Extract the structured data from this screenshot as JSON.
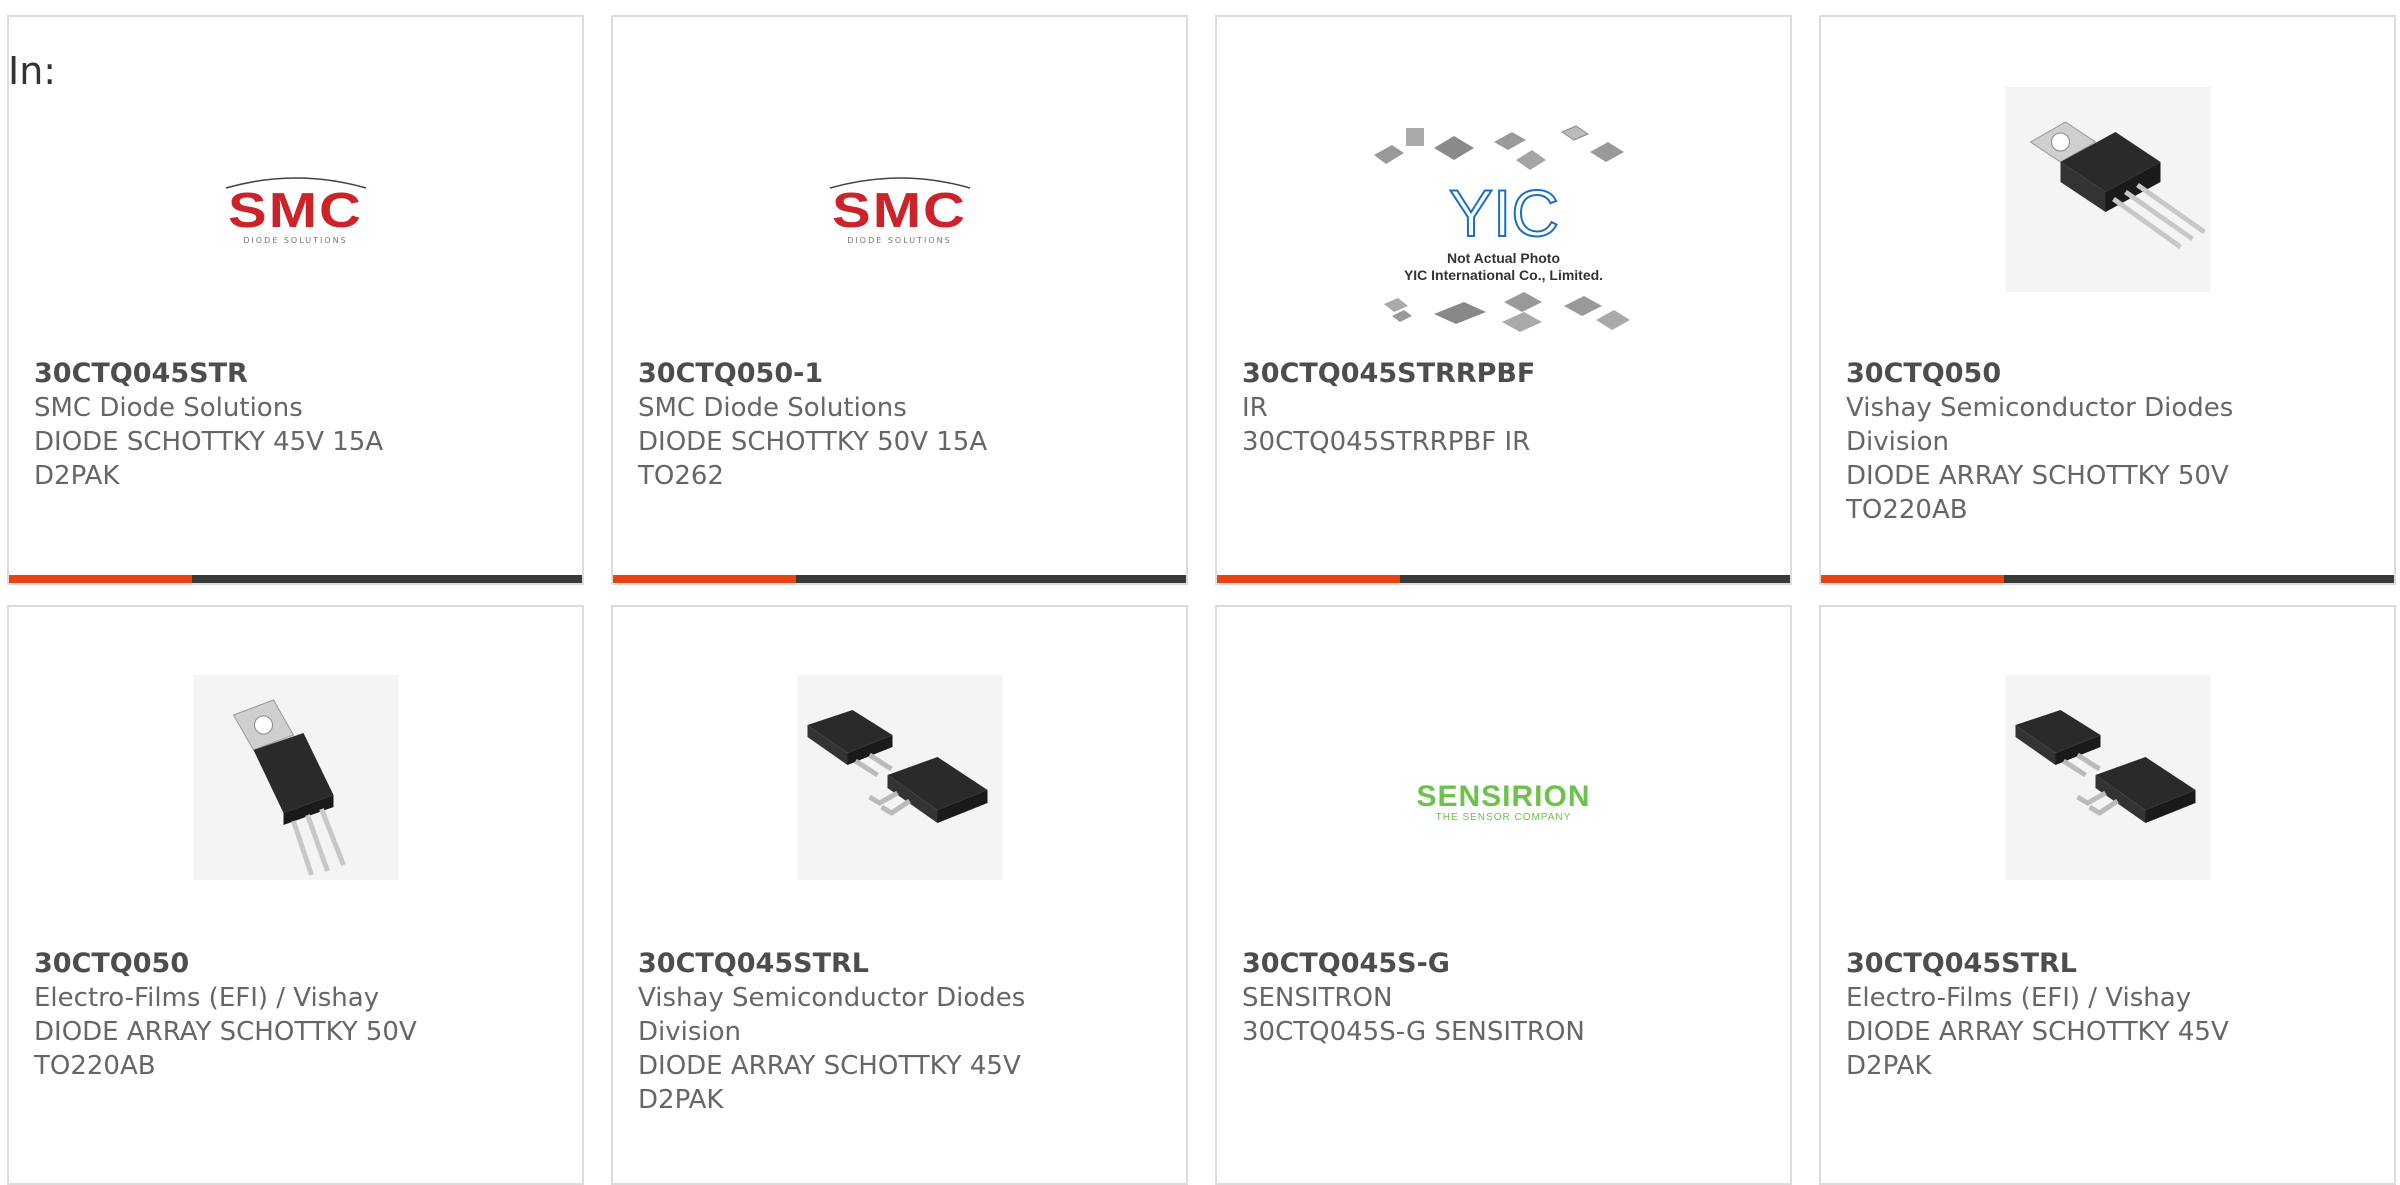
{
  "header": {
    "in_label": "In:"
  },
  "colors": {
    "accent": "#e84315",
    "bar_dark": "#3a3a3a",
    "card_border": "#dcdcdc",
    "text": "#666666"
  },
  "logos": {
    "smc_text": "SMC",
    "smc_sub": "DIODE SOLUTIONS",
    "yic_mark": "YIC",
    "yic_note1": "Not Actual Photo",
    "yic_note2": "YIC International Co., Limited.",
    "sensirion_main": "SENSIRION",
    "sensirion_sub": "THE SENSOR COMPANY"
  },
  "products": [
    {
      "part": "30CTQ045STR",
      "lines": [
        "SMC Diode Solutions",
        "DIODE SCHOTTKY 45V 15A",
        "D2PAK"
      ],
      "image": "smc-logo"
    },
    {
      "part": "30CTQ050-1",
      "lines": [
        "SMC Diode Solutions",
        "DIODE SCHOTTKY 50V 15A",
        "TO262"
      ],
      "image": "smc-logo"
    },
    {
      "part": "30CTQ045STRRPBF",
      "lines": [
        "IR",
        "30CTQ045STRRPBF IR"
      ],
      "image": "yic-placeholder"
    },
    {
      "part": "30CTQ050",
      "lines": [
        "Vishay Semiconductor Diodes",
        "Division",
        "DIODE ARRAY SCHOTTKY 50V",
        "TO220AB"
      ],
      "image": "to220-package"
    },
    {
      "part": "30CTQ050",
      "lines": [
        "Electro-Films (EFI) / Vishay",
        "DIODE ARRAY SCHOTTKY 50V",
        "TO220AB"
      ],
      "image": "to220-package"
    },
    {
      "part": "30CTQ045STRL",
      "lines": [
        "Vishay Semiconductor Diodes",
        "Division",
        "DIODE ARRAY SCHOTTKY 45V",
        "D2PAK"
      ],
      "image": "d2pak-package"
    },
    {
      "part": "30CTQ045S-G",
      "lines": [
        "SENSITRON",
        "30CTQ045S-G SENSITRON"
      ],
      "image": "sensirion-logo"
    },
    {
      "part": "30CTQ045STRL",
      "lines": [
        "Electro-Films (EFI) / Vishay",
        "DIODE ARRAY SCHOTTKY 45V",
        "D2PAK"
      ],
      "image": "d2pak-package"
    }
  ]
}
